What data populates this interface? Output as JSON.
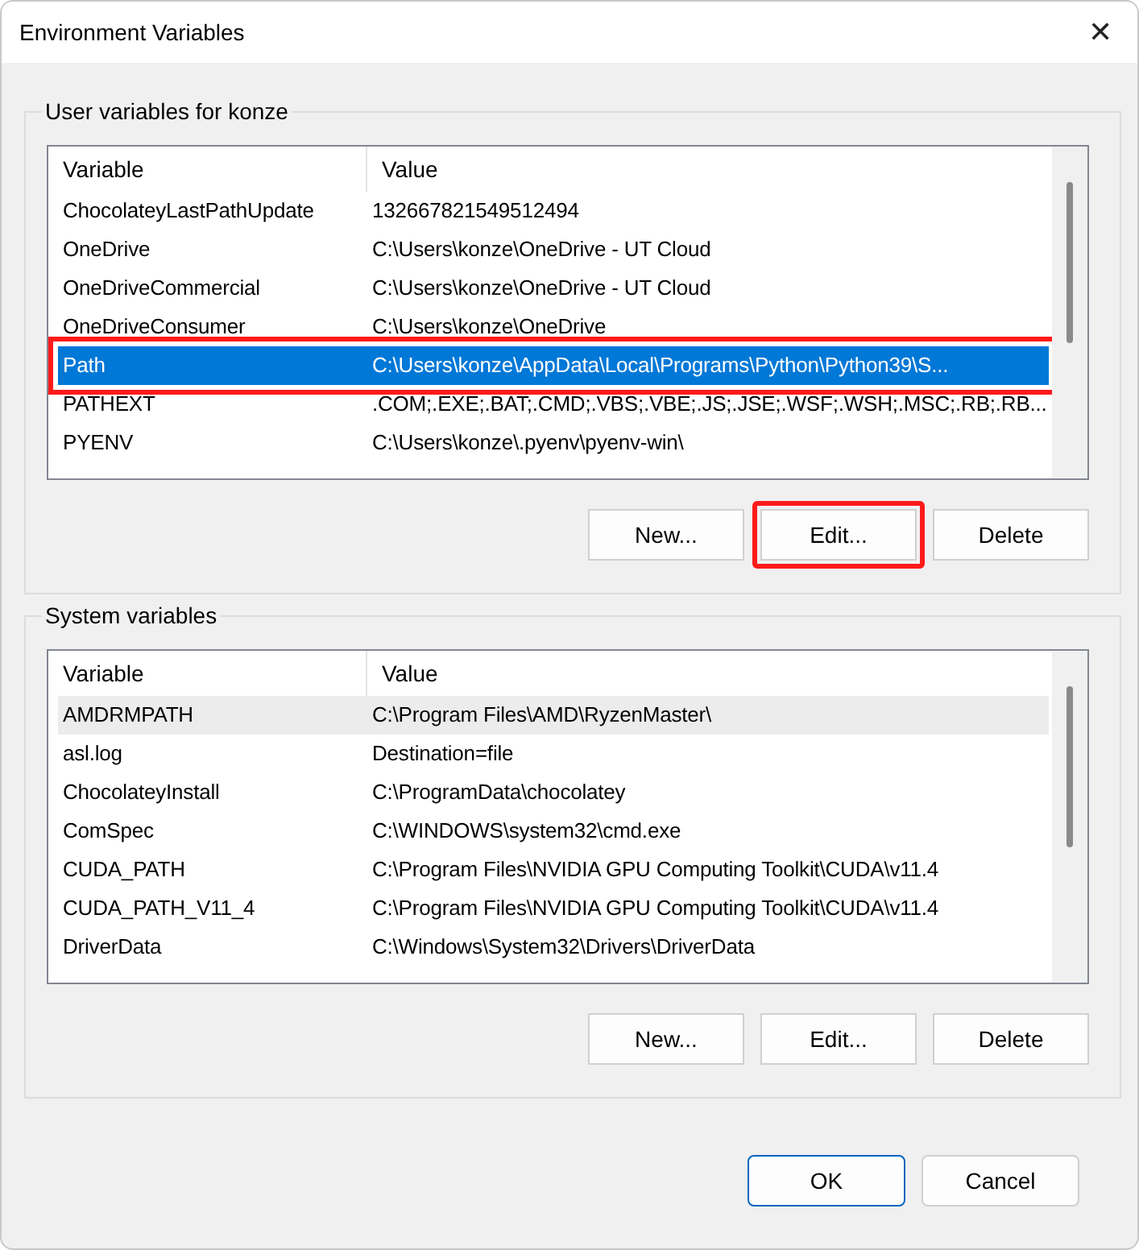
{
  "window": {
    "title": "Environment Variables",
    "close": "✕"
  },
  "groups": [
    {
      "title": "User variables for konze",
      "columns": [
        "Variable",
        "Value"
      ],
      "rows": [
        {
          "variable": "ChocolateyLastPathUpdate",
          "value": "132667821549512494",
          "selected": false,
          "hovered": false,
          "annotated": false
        },
        {
          "variable": "OneDrive",
          "value": "C:\\Users\\konze\\OneDrive - UT Cloud",
          "selected": false,
          "hovered": false,
          "annotated": false
        },
        {
          "variable": "OneDriveCommercial",
          "value": "C:\\Users\\konze\\OneDrive - UT Cloud",
          "selected": false,
          "hovered": false,
          "annotated": false
        },
        {
          "variable": "OneDriveConsumer",
          "value": "C:\\Users\\konze\\OneDrive",
          "selected": false,
          "hovered": false,
          "annotated": false
        },
        {
          "variable": "Path",
          "value": "C:\\Users\\konze\\AppData\\Local\\Programs\\Python\\Python39\\S...",
          "selected": true,
          "hovered": false,
          "annotated": true
        },
        {
          "variable": "PATHEXT",
          "value": ".COM;.EXE;.BAT;.CMD;.VBS;.VBE;.JS;.JSE;.WSF;.WSH;.MSC;.RB;.RB...",
          "selected": false,
          "hovered": false,
          "annotated": false
        },
        {
          "variable": "PYENV",
          "value": "C:\\Users\\konze\\.pyenv\\pyenv-win\\",
          "selected": false,
          "hovered": false,
          "annotated": false
        }
      ],
      "buttons": [
        {
          "label": "New...",
          "annotated": false
        },
        {
          "label": "Edit...",
          "annotated": true
        },
        {
          "label": "Delete",
          "annotated": false
        }
      ]
    },
    {
      "title": "System variables",
      "columns": [
        "Variable",
        "Value"
      ],
      "rows": [
        {
          "variable": "AMDRMPATH",
          "value": "C:\\Program Files\\AMD\\RyzenMaster\\",
          "selected": false,
          "hovered": true,
          "annotated": false
        },
        {
          "variable": "asl.log",
          "value": "Destination=file",
          "selected": false,
          "hovered": false,
          "annotated": false
        },
        {
          "variable": "ChocolateyInstall",
          "value": "C:\\ProgramData\\chocolatey",
          "selected": false,
          "hovered": false,
          "annotated": false
        },
        {
          "variable": "ComSpec",
          "value": "C:\\WINDOWS\\system32\\cmd.exe",
          "selected": false,
          "hovered": false,
          "annotated": false
        },
        {
          "variable": "CUDA_PATH",
          "value": "C:\\Program Files\\NVIDIA GPU Computing Toolkit\\CUDA\\v11.4",
          "selected": false,
          "hovered": false,
          "annotated": false
        },
        {
          "variable": "CUDA_PATH_V11_4",
          "value": "C:\\Program Files\\NVIDIA GPU Computing Toolkit\\CUDA\\v11.4",
          "selected": false,
          "hovered": false,
          "annotated": false
        },
        {
          "variable": "DriverData",
          "value": "C:\\Windows\\System32\\Drivers\\DriverData",
          "selected": false,
          "hovered": false,
          "annotated": false
        }
      ],
      "buttons": [
        {
          "label": "New...",
          "annotated": false
        },
        {
          "label": "Edit...",
          "annotated": false
        },
        {
          "label": "Delete",
          "annotated": false
        }
      ]
    }
  ],
  "footer_buttons": [
    {
      "label": "OK",
      "default": true
    },
    {
      "label": "Cancel",
      "default": false
    }
  ]
}
